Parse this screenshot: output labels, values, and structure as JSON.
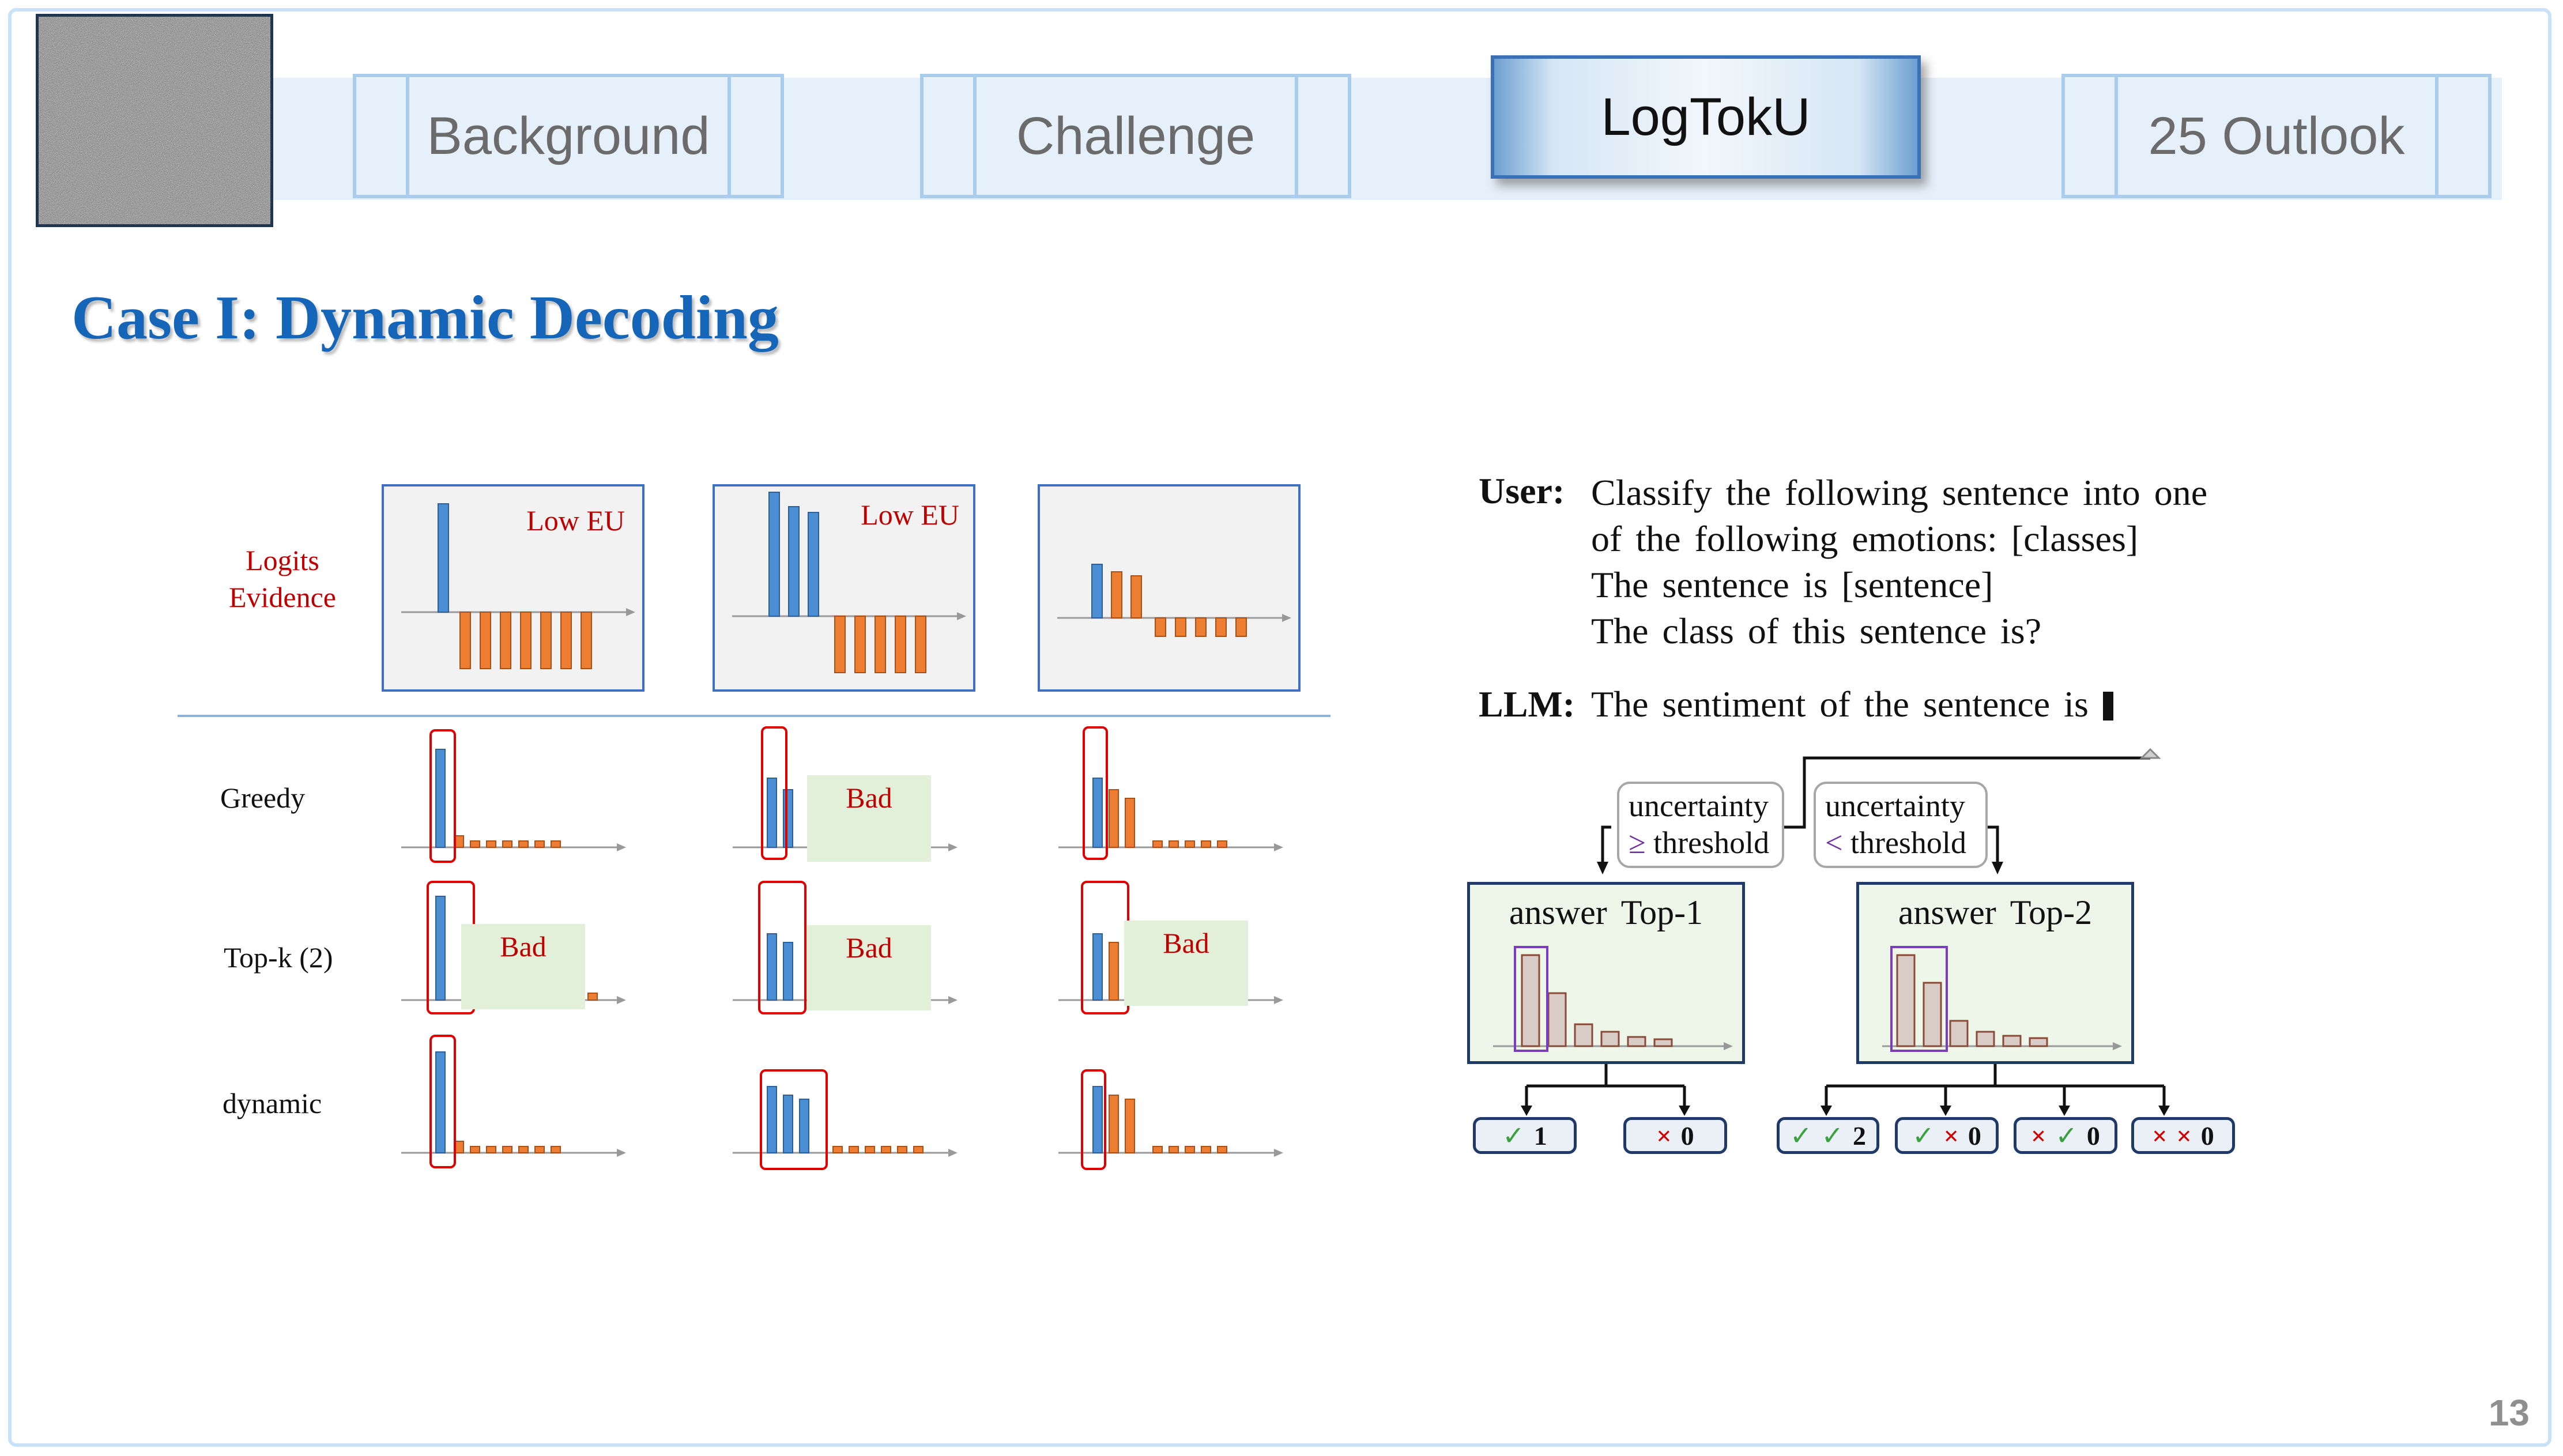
{
  "nav": {
    "tabs": [
      {
        "label": "Background",
        "active": false
      },
      {
        "label": "Challenge",
        "active": false
      },
      {
        "label": "LogTokU",
        "active": true
      },
      {
        "label": "25 Outlook",
        "active": false
      }
    ]
  },
  "slide": {
    "title": "Case I: Dynamic Decoding",
    "page_number": "13"
  },
  "figure_left": {
    "row_header": "Logits\nEvidence",
    "panel_labels": [
      "Low EU",
      "Low EU",
      ""
    ],
    "rows": [
      "Greedy",
      "Top-k (2)",
      "dynamic"
    ],
    "bad_label": "Bad"
  },
  "figure_right": {
    "user_label": "User:",
    "user_lines": [
      "Classify the following sentence into one",
      "of the following emotions: [classes]",
      "The sentence is [sentence]",
      "The class of this sentence is?"
    ],
    "llm_label": "LLM:",
    "llm_text": "The sentiment of the sentence is",
    "cond_left": {
      "line1": "uncertainty",
      "symbol": "≥",
      "line2": "threshold"
    },
    "cond_right": {
      "line1": "uncertainty",
      "symbol": "<",
      "line2": "threshold"
    },
    "box_left_title": "answer Top-1",
    "box_right_title": "answer Top-2",
    "results": [
      {
        "marks": [
          "✓"
        ],
        "count": "1"
      },
      {
        "marks": [
          "×"
        ],
        "count": "0"
      },
      {
        "marks": [
          "✓",
          "✓"
        ],
        "count": "2"
      },
      {
        "marks": [
          "✓",
          "×"
        ],
        "count": "0"
      },
      {
        "marks": [
          "×",
          "✓"
        ],
        "count": "0"
      },
      {
        "marks": [
          "×",
          "×"
        ],
        "count": "0"
      }
    ]
  },
  "colors": {
    "accent_blue": "#1565b8",
    "bar_blue": "#4a8fd4",
    "bar_orange": "#ed7d31",
    "red": "#c00000",
    "bad_bg": "#e3f0d9"
  }
}
